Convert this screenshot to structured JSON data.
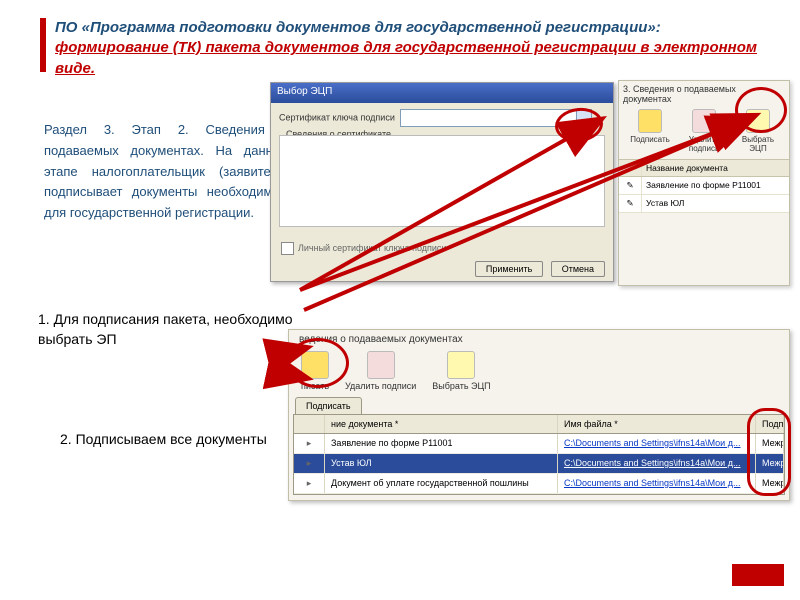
{
  "title_line1": "ПО «Программа подготовки документов для государственной регистрации»:",
  "title_line2": "формирование (ТК) пакета документов для государственной регистрации в электронном виде.",
  "body_text": "Раздел 3. Этап 2. Сведения о подаваемых документах. На данном этапе налогоплательщик (заявитель) подписывает документы необходимые для государственной регистрации.",
  "step1": "1.  Для подписания пакета, необходимо выбрать ЭП",
  "step2": "2. Подписываем все документы",
  "panelA": {
    "title": "Выбор ЭЦП",
    "cert_label": "Сертификат ключа подписи",
    "group_label": "Сведения о сертификате",
    "checkbox_label": "Личный сертификат ключа подписи",
    "btn_apply": "Применить",
    "btn_cancel": "Отмена"
  },
  "panelB": {
    "header": "3. Сведения о подаваемых документах",
    "btn_sign": "Подписать",
    "btn_del": "Удалить подпись",
    "btn_select": "Выбрать ЭЦП",
    "col_name": "Название документа",
    "row1": "Заявление по форме Р11001",
    "row2": "Устав ЮЛ"
  },
  "panelC": {
    "header": "ведения о подаваемых документах",
    "btn_sign": "писать",
    "btn_del": "Удалить подписи",
    "btn_select": "Выбрать ЭЦП",
    "tab": "Подписать",
    "col_name": "ние документа *",
    "col_file": "Имя файла *",
    "col_sign": "Подп",
    "rows": [
      {
        "name": "Заявление по форме Р11001",
        "file": "C:\\Documents and Settings\\ifns14a\\Мои д...",
        "sign": "Межра"
      },
      {
        "name": "Устав ЮЛ",
        "file": "C:\\Documents and Settings\\ifns14a\\Мои д...",
        "sign": "Межра"
      },
      {
        "name": "Документ об уплате государственной пошлины",
        "file": "C:\\Documents and Settings\\ifns14a\\Мои д...",
        "sign": "Межра"
      }
    ]
  }
}
